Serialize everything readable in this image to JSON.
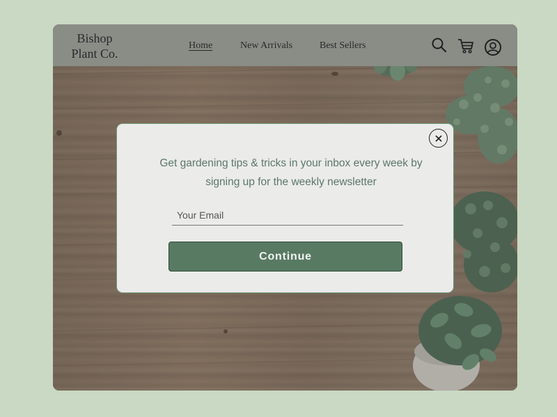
{
  "brand": {
    "line1": "Bishop",
    "line2": "Plant Co."
  },
  "nav": {
    "items": [
      {
        "label": "Home",
        "active": true
      },
      {
        "label": "New Arrivals",
        "active": false
      },
      {
        "label": "Best Sellers",
        "active": false
      }
    ]
  },
  "header_icons": [
    "search-icon",
    "cart-icon",
    "user-account-icon"
  ],
  "modal": {
    "message": "Get gardening tips & tricks in your inbox every week by signing up for the weekly newsletter",
    "email_placeholder": "Your Email",
    "email_value": "",
    "continue_label": "Continue",
    "close_icon": "close-icon"
  },
  "colors": {
    "page_background": "#c9d9c3",
    "header_background": "#8a8c86",
    "modal_background": "#ebebea",
    "modal_border": "#6f9a78",
    "button_color": "#587a63",
    "message_text": "#5c7866"
  }
}
